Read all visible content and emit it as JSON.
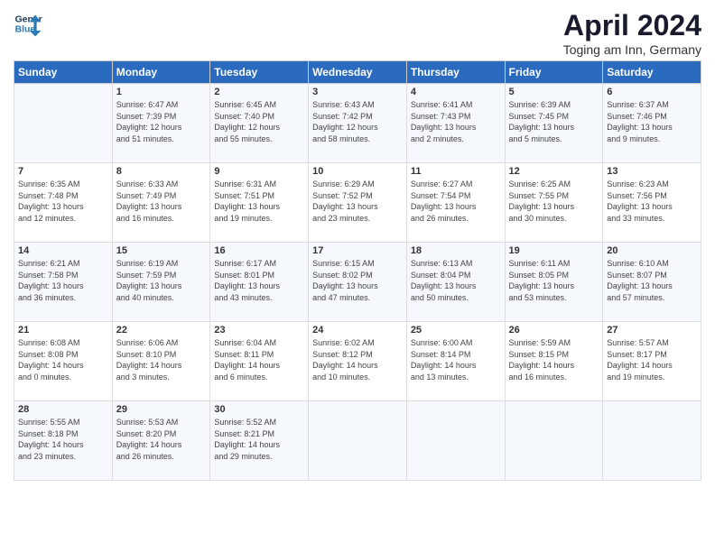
{
  "header": {
    "logo_line1": "General",
    "logo_line2": "Blue",
    "title": "April 2024",
    "location": "Toging am Inn, Germany"
  },
  "weekdays": [
    "Sunday",
    "Monday",
    "Tuesday",
    "Wednesday",
    "Thursday",
    "Friday",
    "Saturday"
  ],
  "weeks": [
    [
      {
        "day": "",
        "content": ""
      },
      {
        "day": "1",
        "content": "Sunrise: 6:47 AM\nSunset: 7:39 PM\nDaylight: 12 hours\nand 51 minutes."
      },
      {
        "day": "2",
        "content": "Sunrise: 6:45 AM\nSunset: 7:40 PM\nDaylight: 12 hours\nand 55 minutes."
      },
      {
        "day": "3",
        "content": "Sunrise: 6:43 AM\nSunset: 7:42 PM\nDaylight: 12 hours\nand 58 minutes."
      },
      {
        "day": "4",
        "content": "Sunrise: 6:41 AM\nSunset: 7:43 PM\nDaylight: 13 hours\nand 2 minutes."
      },
      {
        "day": "5",
        "content": "Sunrise: 6:39 AM\nSunset: 7:45 PM\nDaylight: 13 hours\nand 5 minutes."
      },
      {
        "day": "6",
        "content": "Sunrise: 6:37 AM\nSunset: 7:46 PM\nDaylight: 13 hours\nand 9 minutes."
      }
    ],
    [
      {
        "day": "7",
        "content": "Sunrise: 6:35 AM\nSunset: 7:48 PM\nDaylight: 13 hours\nand 12 minutes."
      },
      {
        "day": "8",
        "content": "Sunrise: 6:33 AM\nSunset: 7:49 PM\nDaylight: 13 hours\nand 16 minutes."
      },
      {
        "day": "9",
        "content": "Sunrise: 6:31 AM\nSunset: 7:51 PM\nDaylight: 13 hours\nand 19 minutes."
      },
      {
        "day": "10",
        "content": "Sunrise: 6:29 AM\nSunset: 7:52 PM\nDaylight: 13 hours\nand 23 minutes."
      },
      {
        "day": "11",
        "content": "Sunrise: 6:27 AM\nSunset: 7:54 PM\nDaylight: 13 hours\nand 26 minutes."
      },
      {
        "day": "12",
        "content": "Sunrise: 6:25 AM\nSunset: 7:55 PM\nDaylight: 13 hours\nand 30 minutes."
      },
      {
        "day": "13",
        "content": "Sunrise: 6:23 AM\nSunset: 7:56 PM\nDaylight: 13 hours\nand 33 minutes."
      }
    ],
    [
      {
        "day": "14",
        "content": "Sunrise: 6:21 AM\nSunset: 7:58 PM\nDaylight: 13 hours\nand 36 minutes."
      },
      {
        "day": "15",
        "content": "Sunrise: 6:19 AM\nSunset: 7:59 PM\nDaylight: 13 hours\nand 40 minutes."
      },
      {
        "day": "16",
        "content": "Sunrise: 6:17 AM\nSunset: 8:01 PM\nDaylight: 13 hours\nand 43 minutes."
      },
      {
        "day": "17",
        "content": "Sunrise: 6:15 AM\nSunset: 8:02 PM\nDaylight: 13 hours\nand 47 minutes."
      },
      {
        "day": "18",
        "content": "Sunrise: 6:13 AM\nSunset: 8:04 PM\nDaylight: 13 hours\nand 50 minutes."
      },
      {
        "day": "19",
        "content": "Sunrise: 6:11 AM\nSunset: 8:05 PM\nDaylight: 13 hours\nand 53 minutes."
      },
      {
        "day": "20",
        "content": "Sunrise: 6:10 AM\nSunset: 8:07 PM\nDaylight: 13 hours\nand 57 minutes."
      }
    ],
    [
      {
        "day": "21",
        "content": "Sunrise: 6:08 AM\nSunset: 8:08 PM\nDaylight: 14 hours\nand 0 minutes."
      },
      {
        "day": "22",
        "content": "Sunrise: 6:06 AM\nSunset: 8:10 PM\nDaylight: 14 hours\nand 3 minutes."
      },
      {
        "day": "23",
        "content": "Sunrise: 6:04 AM\nSunset: 8:11 PM\nDaylight: 14 hours\nand 6 minutes."
      },
      {
        "day": "24",
        "content": "Sunrise: 6:02 AM\nSunset: 8:12 PM\nDaylight: 14 hours\nand 10 minutes."
      },
      {
        "day": "25",
        "content": "Sunrise: 6:00 AM\nSunset: 8:14 PM\nDaylight: 14 hours\nand 13 minutes."
      },
      {
        "day": "26",
        "content": "Sunrise: 5:59 AM\nSunset: 8:15 PM\nDaylight: 14 hours\nand 16 minutes."
      },
      {
        "day": "27",
        "content": "Sunrise: 5:57 AM\nSunset: 8:17 PM\nDaylight: 14 hours\nand 19 minutes."
      }
    ],
    [
      {
        "day": "28",
        "content": "Sunrise: 5:55 AM\nSunset: 8:18 PM\nDaylight: 14 hours\nand 23 minutes."
      },
      {
        "day": "29",
        "content": "Sunrise: 5:53 AM\nSunset: 8:20 PM\nDaylight: 14 hours\nand 26 minutes."
      },
      {
        "day": "30",
        "content": "Sunrise: 5:52 AM\nSunset: 8:21 PM\nDaylight: 14 hours\nand 29 minutes."
      },
      {
        "day": "",
        "content": ""
      },
      {
        "day": "",
        "content": ""
      },
      {
        "day": "",
        "content": ""
      },
      {
        "day": "",
        "content": ""
      }
    ]
  ]
}
